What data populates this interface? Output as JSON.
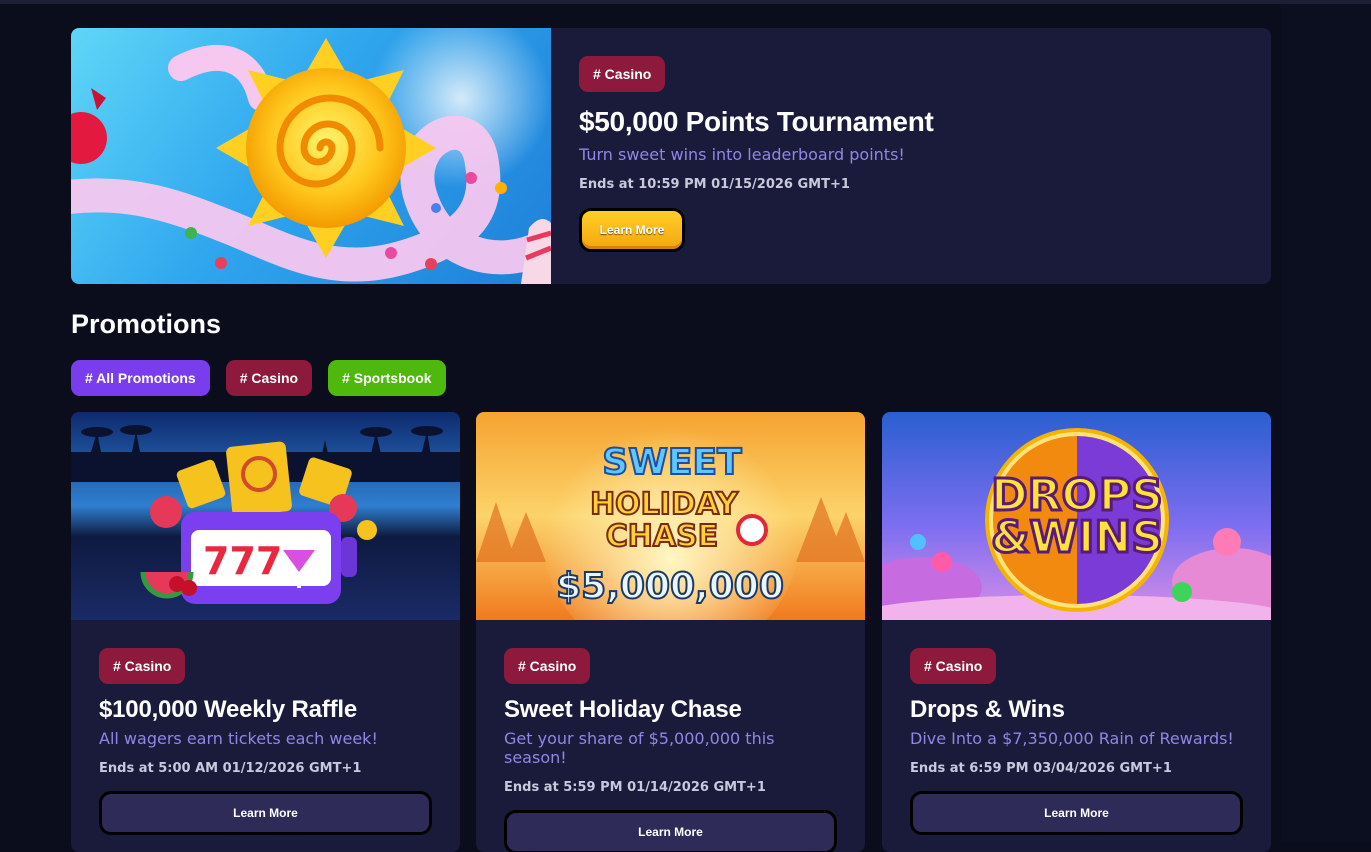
{
  "featured": {
    "tag": "# Casino",
    "title": "$50,000 Points Tournament",
    "subtitle": "Turn sweet wins into leaderboard points!",
    "ends": "Ends at 10:59 PM 01/15/2026 GMT+1",
    "button": "Learn More"
  },
  "section_title": "Promotions",
  "filters": [
    "# All Promotions",
    "# Casino",
    "# Sportsbook"
  ],
  "cards": [
    {
      "tag": "# Casino",
      "title": "$100,000 Weekly Raffle",
      "subtitle": "All wagers earn tickets each week!",
      "ends": "Ends at 5:00 AM 01/12/2026 GMT+1",
      "button": "Learn More",
      "banner_text": "777"
    },
    {
      "tag": "# Casino",
      "title": "Sweet Holiday Chase",
      "subtitle": "Get your share of $5,000,000 this season!",
      "ends": "Ends at 5:59 PM 01/14/2026 GMT+1",
      "button": "Learn More",
      "banner_line1": "SWEET",
      "banner_line2": "HOLIDAY",
      "banner_line3": "CHASE",
      "banner_amount": "$5,000,000"
    },
    {
      "tag": "# Casino",
      "title": "Drops & Wins",
      "subtitle": "Dive Into a $7,350,000 Rain of Rewards!",
      "ends": "Ends at 6:59 PM 03/04/2026 GMT+1",
      "button": "Learn More",
      "banner_line1": "DROPS",
      "banner_line2": "&WINS"
    }
  ],
  "colors": {
    "background": "#0b0d1c",
    "card": "#1a1b3a",
    "casino_tag": "#8d1a3c",
    "all_promotions_tag": "#7a3ded",
    "sportsbook_tag": "#4fb80d",
    "subtitle": "#8f86e6",
    "gold_button": "#f7b817"
  }
}
